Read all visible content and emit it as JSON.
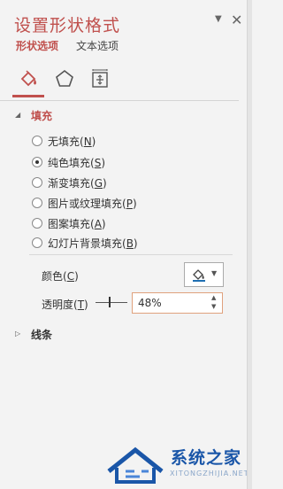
{
  "header": {
    "title": "设置形状格式",
    "caret_icon": "chevron-down-icon",
    "close_icon": "close-icon"
  },
  "tabs": {
    "shape": "形状选项",
    "text": "文本选项"
  },
  "icons": [
    "paint-bucket-icon",
    "pentagon-icon",
    "size-properties-icon"
  ],
  "fill_section": {
    "label": "填充",
    "options": [
      {
        "pre": "无填充(",
        "key": "N",
        "post": ")",
        "selected": false
      },
      {
        "pre": "纯色填充(",
        "key": "S",
        "post": ")",
        "selected": true
      },
      {
        "pre": "渐变填充(",
        "key": "G",
        "post": ")",
        "selected": false
      },
      {
        "pre": "图片或纹理填充(",
        "key": "P",
        "post": ")",
        "selected": false
      },
      {
        "pre": "图案填充(",
        "key": "A",
        "post": ")",
        "selected": false
      },
      {
        "pre": "幻灯片背景填充(",
        "key": "B",
        "post": ")",
        "selected": false
      }
    ],
    "color": {
      "pre": "颜色(",
      "key": "C",
      "post": ")"
    },
    "transparency": {
      "pre": "透明度(",
      "key": "T",
      "post": ")",
      "value": "48%"
    }
  },
  "line_section": {
    "label": "线条"
  },
  "watermark": {
    "name": "系统之家",
    "url": "XITONGZHIJIA.NET"
  },
  "colors": {
    "accent": "#c0504d",
    "background": "#f3f3f3",
    "spin_border": "#e0a17d"
  }
}
